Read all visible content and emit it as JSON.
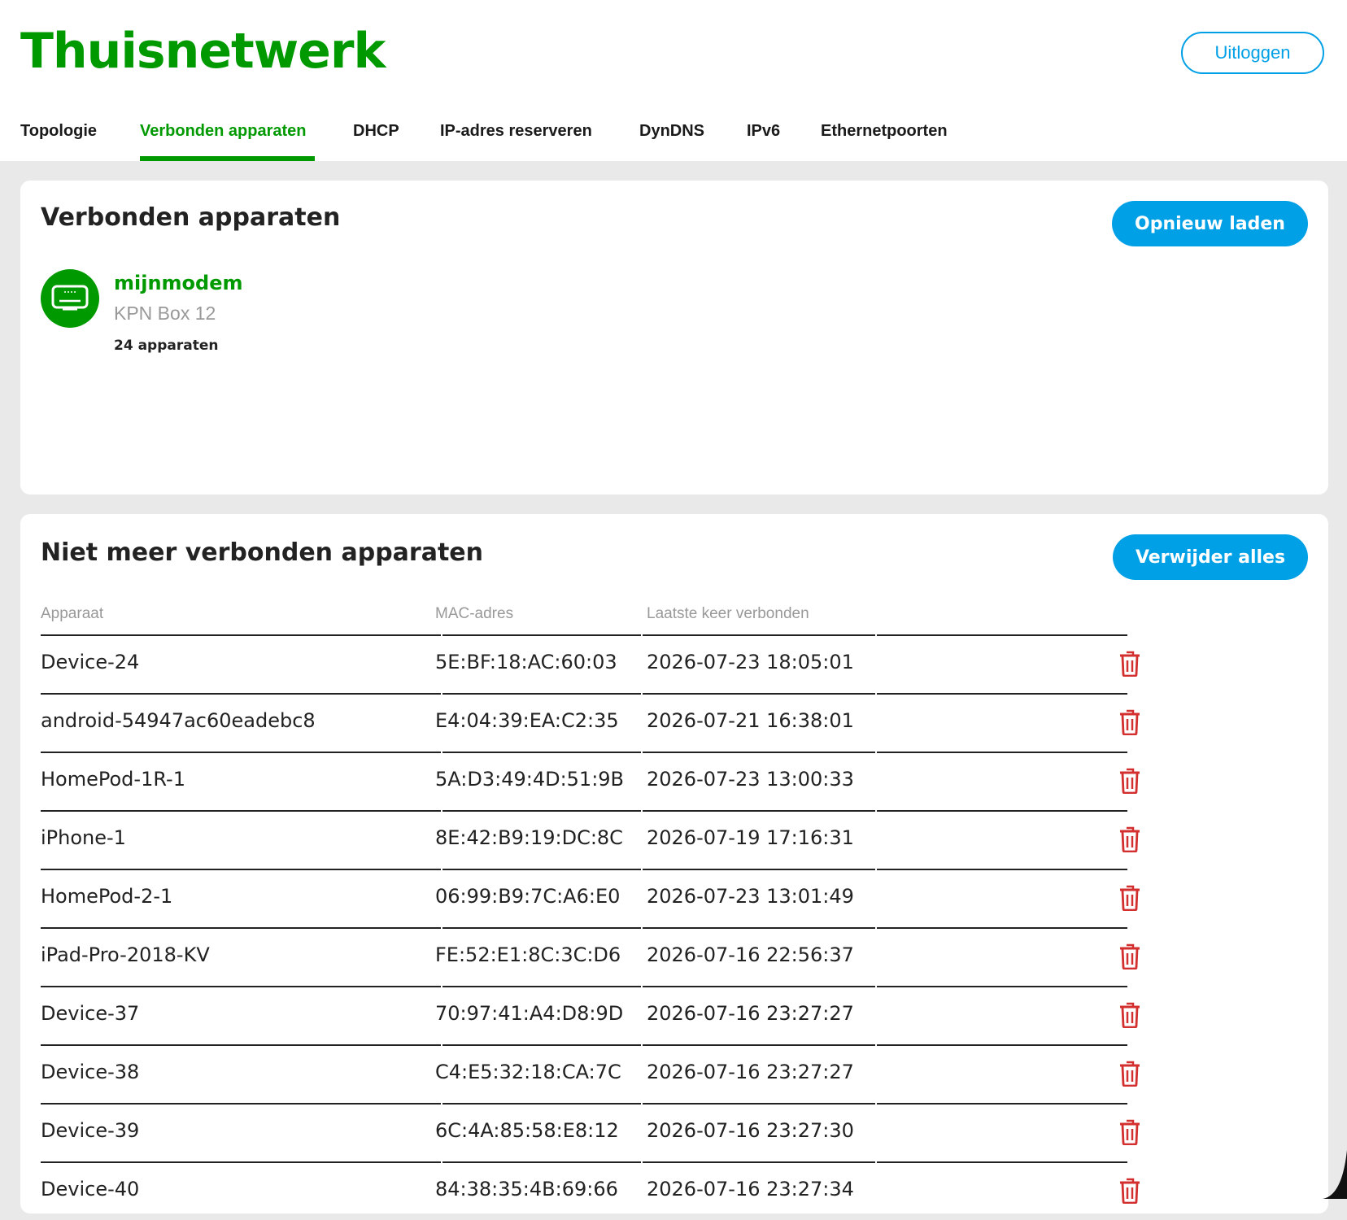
{
  "header": {
    "brand": "Thuisnetwerk",
    "logout_label": "Uitloggen",
    "tabs": [
      {
        "label": "Topologie",
        "active": false
      },
      {
        "label": "Verbonden apparaten",
        "active": true
      },
      {
        "label": "DHCP",
        "active": false
      },
      {
        "label": "IP-adres reserveren",
        "active": false
      },
      {
        "label": "DynDNS",
        "active": false
      },
      {
        "label": "IPv6",
        "active": false
      },
      {
        "label": "Ethernetpoorten",
        "active": false
      }
    ]
  },
  "connected": {
    "title": "Verbonden apparaten",
    "reload_label": "Opnieuw laden",
    "modem": {
      "name": "mijnmodem",
      "model": "KPN Box 12",
      "count": "24 apparaten",
      "icon": "modem-icon"
    }
  },
  "disconnected": {
    "title": "Niet meer verbonden apparaten",
    "remove_all_label": "Verwijder alles",
    "columns": [
      "Apparaat",
      "MAC-adres",
      "Laatste keer verbonden"
    ],
    "rows": [
      {
        "device": "Device-24",
        "mac": "5E:BF:18:AC:60:03",
        "last": "2026-07-23 18:05:01"
      },
      {
        "device": "android-54947ac60eadebc8",
        "mac": "E4:04:39:EA:C2:35",
        "last": "2026-07-21 16:38:01"
      },
      {
        "device": "HomePod-1R-1",
        "mac": "5A:D3:49:4D:51:9B",
        "last": "2026-07-23 13:00:33"
      },
      {
        "device": "iPhone-1",
        "mac": "8E:42:B9:19:DC:8C",
        "last": "2026-07-19 17:16:31"
      },
      {
        "device": "HomePod-2-1",
        "mac": "06:99:B9:7C:A6:E0",
        "last": "2026-07-23 13:01:49"
      },
      {
        "device": "iPad-Pro-2018-KV",
        "mac": "FE:52:E1:8C:3C:D6",
        "last": "2026-07-16 22:56:37"
      },
      {
        "device": "Device-37",
        "mac": "70:97:41:A4:D8:9D",
        "last": "2026-07-16 23:27:27"
      },
      {
        "device": "Device-38",
        "mac": "C4:E5:32:18:CA:7C",
        "last": "2026-07-16 23:27:27"
      },
      {
        "device": "Device-39",
        "mac": "6C:4A:85:58:E8:12",
        "last": "2026-07-16 23:27:30"
      },
      {
        "device": "Device-40",
        "mac": "84:38:35:4B:69:66",
        "last": "2026-07-16 23:27:34"
      }
    ]
  },
  "colors": {
    "brand_green": "#009900",
    "accent_blue": "#00a0e6",
    "delete_red": "#d32f2f"
  }
}
